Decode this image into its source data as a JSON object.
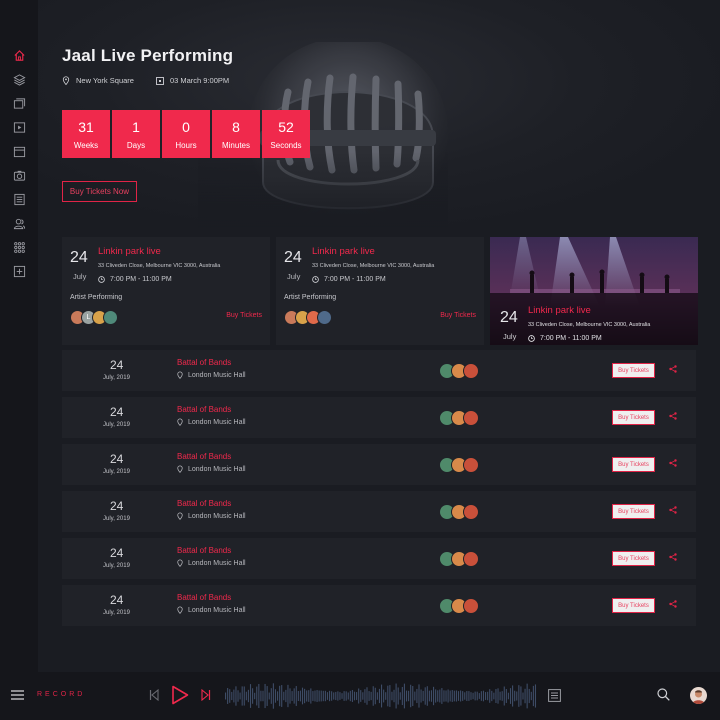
{
  "hero": {
    "title": "Jaal Live Performing",
    "location": "New York Square",
    "datetime": "03 March 9:00PM",
    "countdown": [
      {
        "value": "31",
        "label": "Weeks"
      },
      {
        "value": "1",
        "label": "Days"
      },
      {
        "value": "0",
        "label": "Hours"
      },
      {
        "value": "8",
        "label": "Minutes"
      },
      {
        "value": "52",
        "label": "Seconds"
      }
    ],
    "buy_label": "Buy Tickets Now"
  },
  "sidebar": {
    "items": [
      {
        "icon": "home-icon",
        "active": true
      },
      {
        "icon": "layers-icon"
      },
      {
        "icon": "albums-icon"
      },
      {
        "icon": "video-icon"
      },
      {
        "icon": "calendar-icon"
      },
      {
        "icon": "camera-icon"
      },
      {
        "icon": "news-icon"
      },
      {
        "icon": "users-icon"
      },
      {
        "icon": "grid-icon"
      },
      {
        "icon": "add-icon"
      }
    ]
  },
  "featured": [
    {
      "day": "24",
      "month": "July",
      "title": "Linkin park live",
      "address": "33 Cliveden Close, Melbourne VIC 3000, Australia",
      "time": "7:00 PM - 11:00 PM",
      "artist_label": "Artist Performing",
      "buy_label": "Buy Tickets"
    },
    {
      "day": "24",
      "month": "July",
      "title": "Linkin park live",
      "address": "33 Cliveden Close, Melbourne VIC 3000, Australia",
      "time": "7:00 PM - 11:00 PM",
      "artist_label": "Artist Performing",
      "buy_label": "Buy Tickets"
    },
    {
      "day": "24",
      "month": "July",
      "title": "Linkin park live",
      "address": "33 Cliveden Close, Melbourne VIC 3000, Australia",
      "time": "7:00 PM - 11:00 PM"
    }
  ],
  "events": [
    {
      "day": "24",
      "date": "July, 2019",
      "title": "Battal of Bands",
      "place": "London Music Hall",
      "buy_label": "Buy Tickets"
    },
    {
      "day": "24",
      "date": "July, 2019",
      "title": "Battal of Bands",
      "place": "London Music Hall",
      "buy_label": "Buy Tickets"
    },
    {
      "day": "24",
      "date": "July, 2019",
      "title": "Battal of Bands",
      "place": "London Music Hall",
      "buy_label": "Buy Tickets"
    },
    {
      "day": "24",
      "date": "July, 2019",
      "title": "Battal of Bands",
      "place": "London Music Hall",
      "buy_label": "Buy Tickets"
    },
    {
      "day": "24",
      "date": "July, 2019",
      "title": "Battal of Bands",
      "place": "London Music Hall",
      "buy_label": "Buy Tickets"
    },
    {
      "day": "24",
      "date": "July, 2019",
      "title": "Battal of Bands",
      "place": "London Music Hall",
      "buy_label": "Buy Tickets"
    }
  ],
  "player": {
    "label": "RECORD"
  },
  "colors": {
    "accent": "#f0294c",
    "background": "#1a1c22",
    "panel": "#202228"
  }
}
